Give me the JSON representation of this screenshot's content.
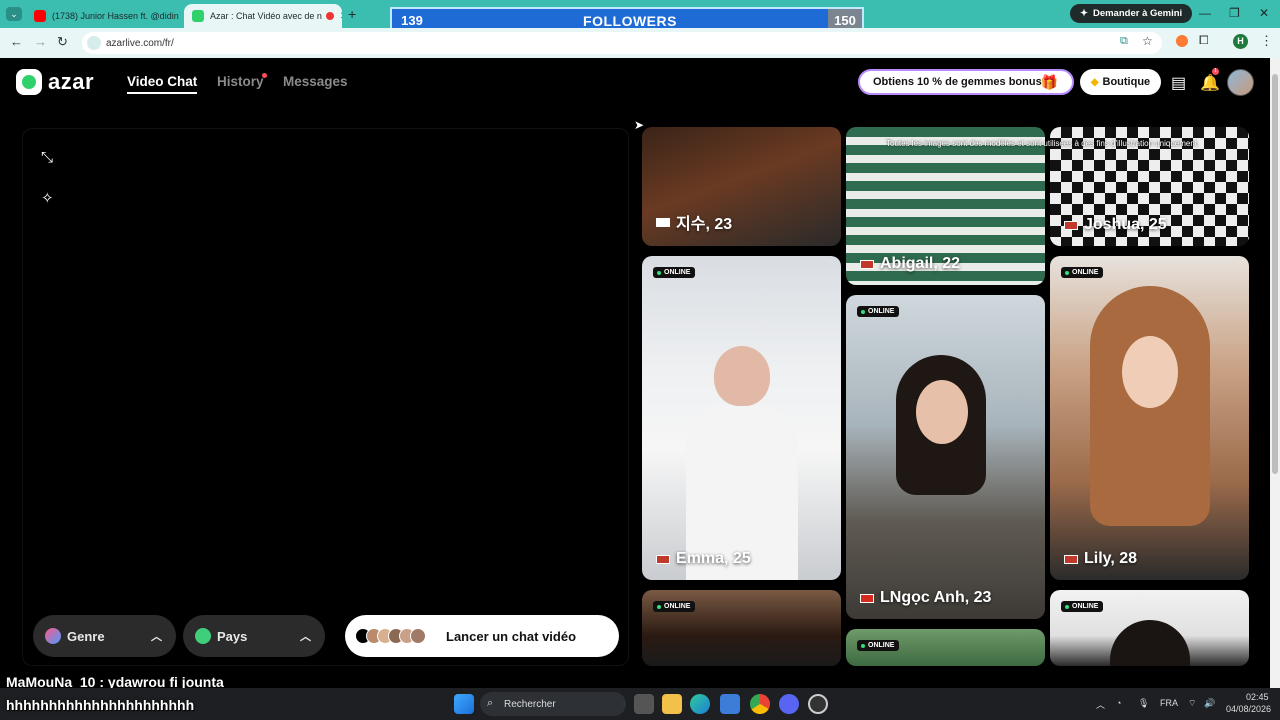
{
  "browser": {
    "tabs": [
      {
        "title": "(1738) Junior Hassen ft. @didin",
        "active": false
      },
      {
        "title": "Azar : Chat Vidéo avec de n",
        "active": true
      }
    ],
    "new_tab": "+",
    "url": "azarlive.com/fr/",
    "gemini": "Demander à Gemini",
    "profile_initial": "H"
  },
  "followers": {
    "current": "139",
    "label": "FOLLOWERS",
    "goal": "150"
  },
  "app": {
    "logo": "azar",
    "nav": {
      "video_chat": "Video Chat",
      "history": "History",
      "messages": "Messages"
    },
    "promo": "Obtiens 10 % de gemmes bonus !",
    "boutique": "Boutique",
    "notif_count": "1"
  },
  "video_panel": {
    "genre": "Genre",
    "pays": "Pays",
    "launch": "Lancer un chat vidéo"
  },
  "disclaimer": "Toutes les images sont des modèles et sont utilisées à des fins d'illustration uniquement.",
  "online_label": "ONLINE",
  "cards": [
    {
      "name": "지수, 23"
    },
    {
      "name": "Abigail, 22"
    },
    {
      "name": "Joshua, 25"
    },
    {
      "name": "Emma, 25"
    },
    {
      "name": "LNgọc Anh, 23"
    },
    {
      "name": "Lily, 28"
    }
  ],
  "chat_overlay": {
    "line1": "MaMouNa_10 : ydawrou fi jounta",
    "line2": "hhhhhhhhhhhhhhhhhhhhhh"
  },
  "taskbar": {
    "search": "Rechercher",
    "lang": "FRA",
    "time": "02:45",
    "date": "04/08/2026"
  }
}
